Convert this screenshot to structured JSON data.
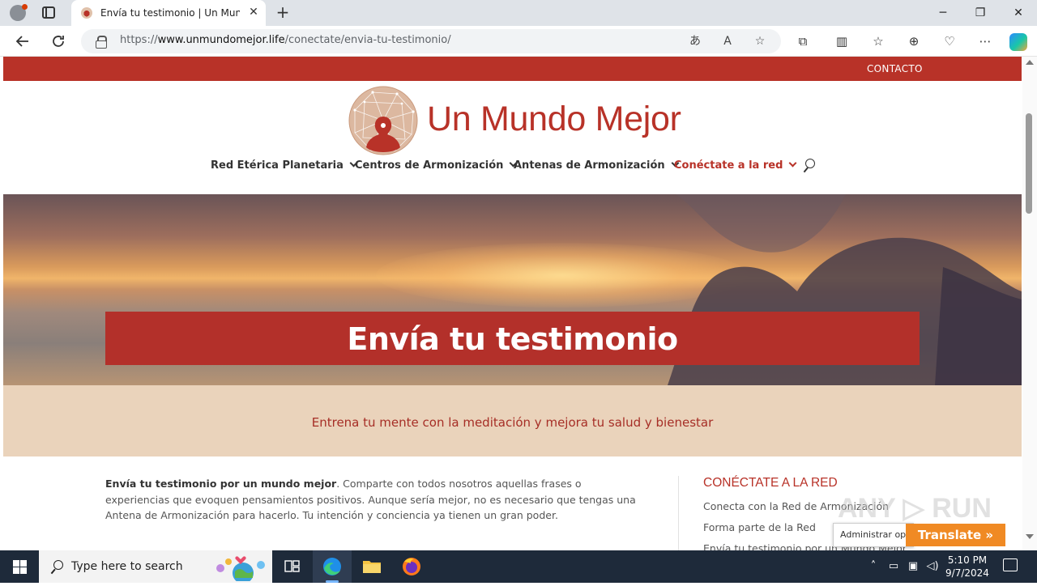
{
  "browser": {
    "tab_title": "Envía tu testimonio | Un Mundo Mejor",
    "tab_close": "✕",
    "new_tab": "+",
    "url_prefix": "https://",
    "url_host": "www.unmundomejor.life",
    "url_path": "/conectate/envia-tu-testimonio/",
    "window_minimize": "─",
    "window_restore": "❐",
    "window_close": "✕"
  },
  "site": {
    "top_link": "CONTACTO",
    "brand": "Un Mundo Mejor",
    "menu": [
      {
        "label": "Red Etérica Planetaria"
      },
      {
        "label": "Centros de Armonización"
      },
      {
        "label": "Antenas de Armonización"
      },
      {
        "label": "Conéctate a la red"
      }
    ],
    "accent_color": "#b83228",
    "hero_title": "Envía tu testimonio",
    "tagline": "Entrena tu mente con la meditación y mejora tu salud y bienestar",
    "content": {
      "lead_bold": "Envía tu testimonio por un mundo mejor",
      "lead_rest": ". Comparte con todos nosotros aquellas frases o experiencias que evoquen pensamientos positivos. Aunque sería mejor, no es necesario que tengas una Antena de Armonización para hacerlo. Tu intención y conciencia ya tienen un gran poder."
    },
    "sidebar": {
      "title": "CONÉCTATE A LA RED",
      "links": [
        "Conecta con la Red de Armonización",
        "Forma parte de la Red",
        "Envía tu testimonio por un Mundo Mejor"
      ]
    }
  },
  "overlays": {
    "watermark": "ANY ▷ RUN",
    "admin_popup": "Administrar opciones",
    "translate_button": "Translate »"
  },
  "taskbar": {
    "search_placeholder": "Type here to search",
    "time": "5:10 PM",
    "date": "9/7/2024"
  }
}
